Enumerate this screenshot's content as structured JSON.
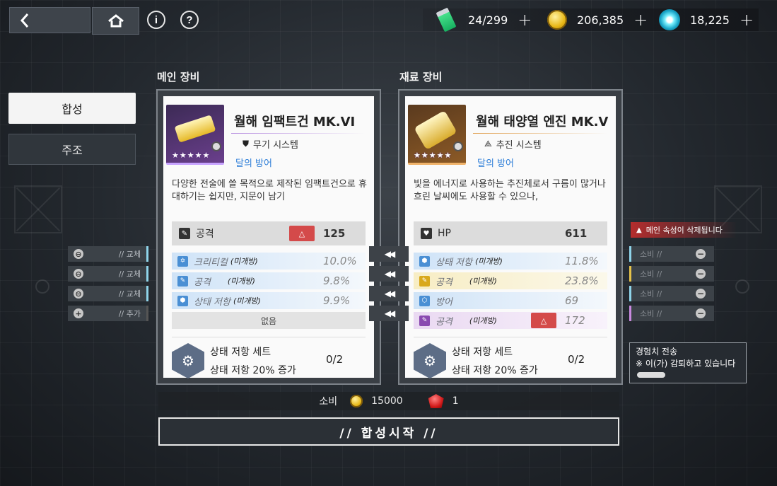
{
  "topbar": {
    "info_label": "i",
    "help_label": "?",
    "resources": [
      {
        "icon": "stamina-icon",
        "value": "24/299"
      },
      {
        "icon": "gold-coin-icon",
        "value": "206,385"
      },
      {
        "icon": "crystal-gem-icon",
        "value": "18,225"
      }
    ],
    "plus_label": "+"
  },
  "tabs": [
    {
      "label": "합성",
      "active": true
    },
    {
      "label": "주조",
      "active": false
    }
  ],
  "main_label": "메인 장비",
  "material_label": "재료 장비",
  "main_card": {
    "name": "월해 임팩트건 MK.VI",
    "system": "무기 시스템",
    "set": "달의 방어",
    "desc": "다양한 전술에 쓸 목적으로 제작된 임팩트건으로 휴대하기는 쉽지만, 지문이 남기",
    "stars": "★★★★★",
    "main_stat": {
      "label": "공격",
      "value": "125"
    },
    "substats": [
      {
        "label": "크리티컬",
        "tag": "(미개방)",
        "value": "10.0%"
      },
      {
        "label": "공격",
        "tag": "(미개방)",
        "value": "9.8%"
      },
      {
        "label": "상태 저항",
        "tag": "(미개방)",
        "value": "9.9%"
      }
    ],
    "empty_slot": "없음",
    "set_bonus": {
      "title": "상태 저항 세트",
      "desc": "상태 저항 20% 증가",
      "count": "0/2"
    }
  },
  "material_card": {
    "name": "월해 태양열 엔진 MK.V",
    "system": "추진 시스템",
    "set": "달의 방어",
    "desc": "빛을 에너지로 사용하는 추진체로서 구름이 많거나 흐린 날씨에도 사용할 수 있으나,",
    "stars": "★★★★★",
    "main_stat": {
      "label": "HP",
      "value": "611"
    },
    "substats": [
      {
        "label": "상태 저항",
        "tag": "(미개방)",
        "value": "11.8%"
      },
      {
        "label": "공격",
        "tag": "(미개방)",
        "value": "23.8%"
      },
      {
        "label": "방어",
        "tag": "",
        "value": "69"
      },
      {
        "label": "공격",
        "tag": "(미개방)",
        "value": "172"
      }
    ],
    "set_bonus": {
      "title": "상태 저항 세트",
      "desc": "상태 저항 20% 증가",
      "count": "0/2"
    }
  },
  "arrows": "◀◀",
  "left_slots": [
    {
      "icon": "⊖",
      "label": "// 교체"
    },
    {
      "icon": "⊖",
      "label": "// 교체"
    },
    {
      "icon": "⊖",
      "label": "// 교체"
    },
    {
      "icon": "+",
      "label": "// 추가"
    }
  ],
  "right_slots": [
    {
      "label": "소비 //"
    },
    {
      "label": "소비 //"
    },
    {
      "label": "소비 //"
    },
    {
      "label": "소비 //"
    }
  ],
  "warning": "메인 속성이 삭제됩니다",
  "exp_box": {
    "title": "경험치 전송",
    "desc": "※ 이(가) 감퇴하고 있습니다"
  },
  "cost": {
    "label": "소비",
    "gold": "15000",
    "ruby": "1"
  },
  "start_button": "// 합성시작 //",
  "colors": {
    "accent_blue": "#8fd4ea",
    "warning_red": "#d44a4a",
    "set_blue": "#2f7fd8"
  }
}
